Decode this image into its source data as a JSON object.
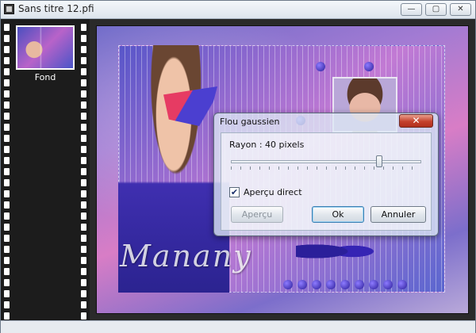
{
  "window": {
    "title": "Sans titre 12.pfi",
    "min_glyph": "—",
    "max_glyph": "▢",
    "close_glyph": "✕"
  },
  "filmstrip": {
    "thumbnail_label": "Fond"
  },
  "image": {
    "signature_text": "Manany"
  },
  "dialog": {
    "title": "Flou gaussien",
    "close_glyph": "✕",
    "radius_label": "Rayon : 40 pixels",
    "radius_slider_fraction": 0.78,
    "preview_checked": true,
    "preview_label": "Aperçu direct",
    "preview_button": "Aperçu",
    "ok_button": "Ok",
    "cancel_button": "Annuler"
  }
}
